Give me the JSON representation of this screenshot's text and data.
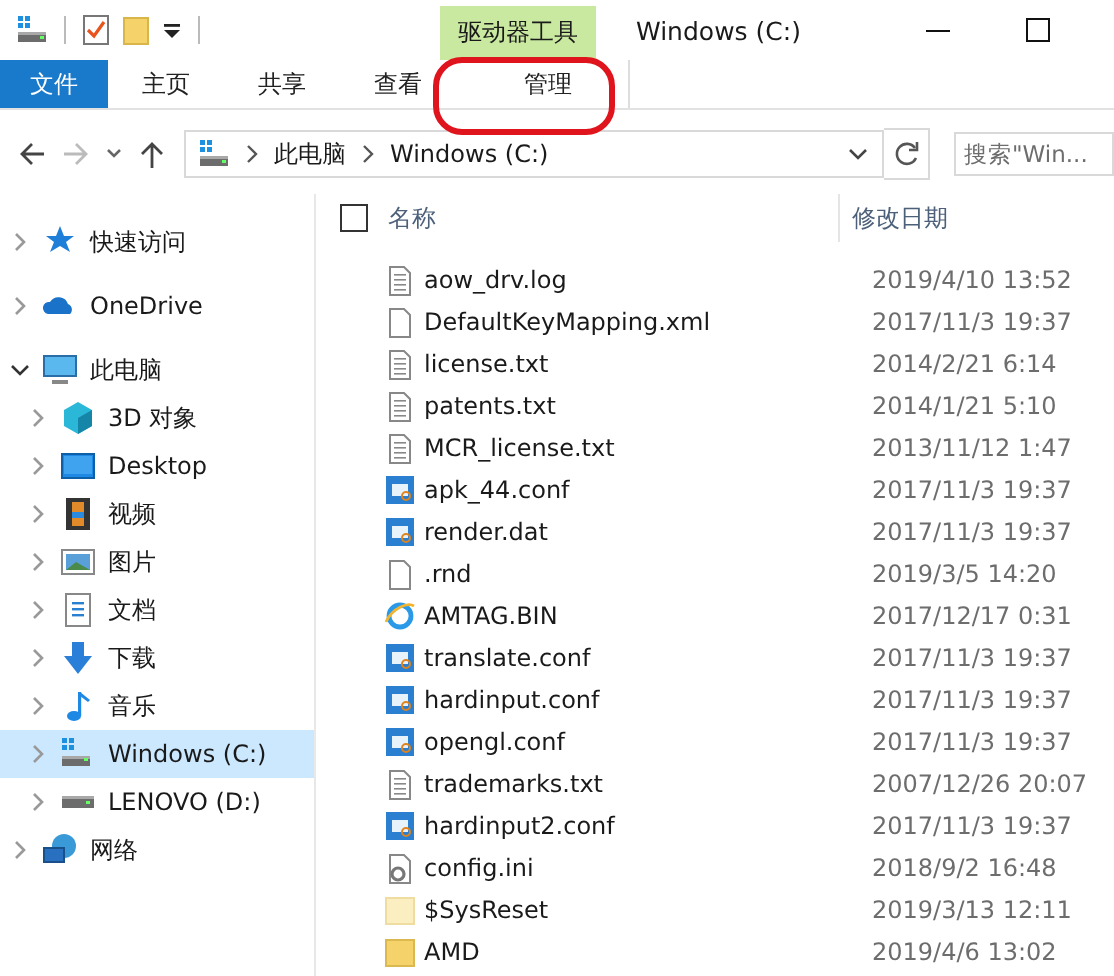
{
  "title_bar": {
    "context_tab": "驱动器工具",
    "title": "Windows (C:)"
  },
  "ribbon_tabs": [
    {
      "label": "文件",
      "kind": "file",
      "selected": false
    },
    {
      "label": "主页",
      "kind": "tab",
      "selected": false
    },
    {
      "label": "共享",
      "kind": "tab",
      "selected": false
    },
    {
      "label": "查看",
      "kind": "tab",
      "selected": false
    },
    {
      "label": "管理",
      "kind": "context",
      "selected": false
    }
  ],
  "address": {
    "crumbs": [
      "此电脑",
      "Windows (C:)"
    ],
    "search_placeholder": "搜索\"Win..."
  },
  "sidebar": {
    "items": [
      {
        "label": "快速访问",
        "kind": "star",
        "expanded": false,
        "selected": false
      },
      {
        "label": "OneDrive",
        "kind": "cloud",
        "expanded": false,
        "selected": false
      },
      {
        "label": "此电脑",
        "kind": "pc",
        "expanded": true,
        "selected": false,
        "children": [
          {
            "label": "3D 对象",
            "kind": "cube",
            "expanded": false,
            "selected": false
          },
          {
            "label": "Desktop",
            "kind": "desktop",
            "expanded": false,
            "selected": false
          },
          {
            "label": "视频",
            "kind": "film",
            "expanded": false,
            "selected": false
          },
          {
            "label": "图片",
            "kind": "image",
            "expanded": false,
            "selected": false
          },
          {
            "label": "文档",
            "kind": "doc",
            "expanded": false,
            "selected": false
          },
          {
            "label": "下载",
            "kind": "download",
            "expanded": false,
            "selected": false
          },
          {
            "label": "音乐",
            "kind": "music",
            "expanded": false,
            "selected": false
          },
          {
            "label": "Windows (C:)",
            "kind": "sysdrive",
            "expanded": false,
            "selected": true
          },
          {
            "label": "LENOVO (D:)",
            "kind": "drive",
            "expanded": false,
            "selected": false
          }
        ]
      },
      {
        "label": "网络",
        "kind": "network",
        "expanded": false,
        "selected": false
      }
    ]
  },
  "file_list": {
    "select_all": {
      "checked": false
    },
    "columns": [
      "名称",
      "修改日期"
    ],
    "rows": [
      {
        "name": "aow_drv.log",
        "date": "2019/4/10 13:52",
        "kind": "text"
      },
      {
        "name": "DefaultKeyMapping.xml",
        "date": "2017/11/3 19:37",
        "kind": "blank"
      },
      {
        "name": "license.txt",
        "date": "2014/2/21 6:14",
        "kind": "text"
      },
      {
        "name": "patents.txt",
        "date": "2014/1/21 5:10",
        "kind": "text"
      },
      {
        "name": "MCR_license.txt",
        "date": "2013/11/12 1:47",
        "kind": "text"
      },
      {
        "name": "apk_44.conf",
        "date": "2017/11/3 19:37",
        "kind": "conf"
      },
      {
        "name": "render.dat",
        "date": "2017/11/3 19:37",
        "kind": "conf"
      },
      {
        "name": ".rnd",
        "date": "2019/3/5 14:20",
        "kind": "blank"
      },
      {
        "name": "AMTAG.BIN",
        "date": "2017/12/17 0:31",
        "kind": "web"
      },
      {
        "name": "translate.conf",
        "date": "2017/11/3 19:37",
        "kind": "conf"
      },
      {
        "name": "hardinput.conf",
        "date": "2017/11/3 19:37",
        "kind": "conf"
      },
      {
        "name": "opengl.conf",
        "date": "2017/11/3 19:37",
        "kind": "conf"
      },
      {
        "name": "trademarks.txt",
        "date": "2007/12/26 20:07",
        "kind": "text"
      },
      {
        "name": "hardinput2.conf",
        "date": "2017/11/3 19:37",
        "kind": "conf"
      },
      {
        "name": "config.ini",
        "date": "2018/9/2 16:48",
        "kind": "settings"
      },
      {
        "name": "$SysReset",
        "date": "2019/3/13 12:11",
        "kind": "hidden-folder"
      },
      {
        "name": "AMD",
        "date": "2019/4/6 13:02",
        "kind": "folder"
      }
    ]
  }
}
